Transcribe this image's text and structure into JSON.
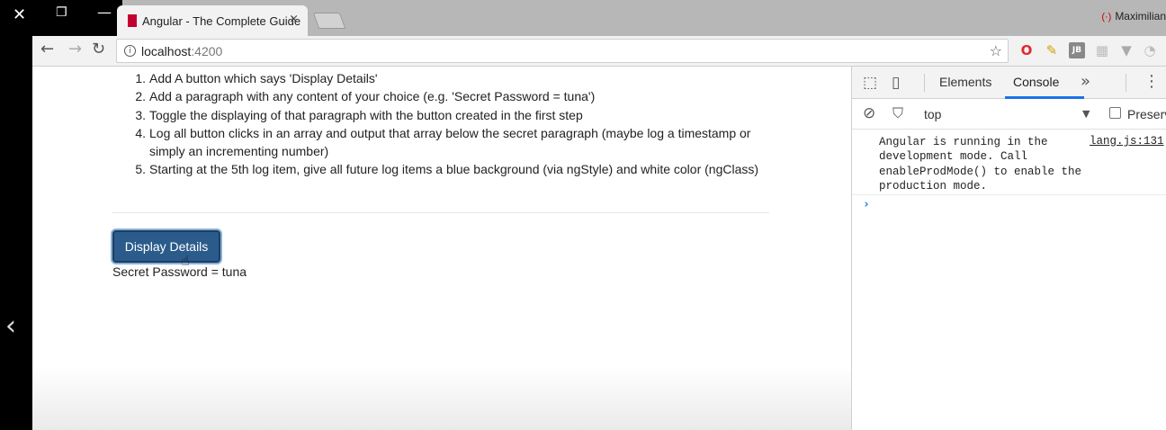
{
  "window": {
    "close_icon": "✕",
    "restore_icon": "❐",
    "minimize_icon": "—"
  },
  "tab": {
    "title": "Angular - The Complete Guide",
    "close": "×"
  },
  "profile": {
    "name": "Maximilian"
  },
  "toolbar": {
    "back": "←",
    "forward": "→",
    "reload": "↻",
    "url_host": "localhost",
    "url_port": ":4200"
  },
  "extensions": [
    "opera-icon",
    "color-picker-icon",
    "jb-icon",
    "grid-icon",
    "vue-icon",
    "extension-icon"
  ],
  "steps": [
    {
      "num": "1.",
      "text": "Add A button which says 'Display Details'"
    },
    {
      "num": "2.",
      "text": "Add a paragraph with any content of your choice (e.g. 'Secret Password = tuna')"
    },
    {
      "num": "3.",
      "text": "Toggle the displaying of that paragraph with the button created in the first step"
    },
    {
      "num": "4.",
      "text": "Log all button clicks in an array and output that array below the secret paragraph (maybe log a timestamp or simply an incrementing number)"
    },
    {
      "num": "5.",
      "text": "Starting at the 5th log item, give all future log items a blue background (via ngStyle) and white color (ngClass)"
    }
  ],
  "button": {
    "label": "Display Details"
  },
  "secret": {
    "text": "Secret Password = tuna"
  },
  "devtools": {
    "tab_elements": "Elements",
    "tab_console": "Console",
    "more": "»",
    "context": "top",
    "preserve_log": "Preserve log",
    "message": "Angular is running in the development mode. Call enableProdMode() to enable the production mode.",
    "source": "lang.js:131",
    "prompt": "›"
  }
}
